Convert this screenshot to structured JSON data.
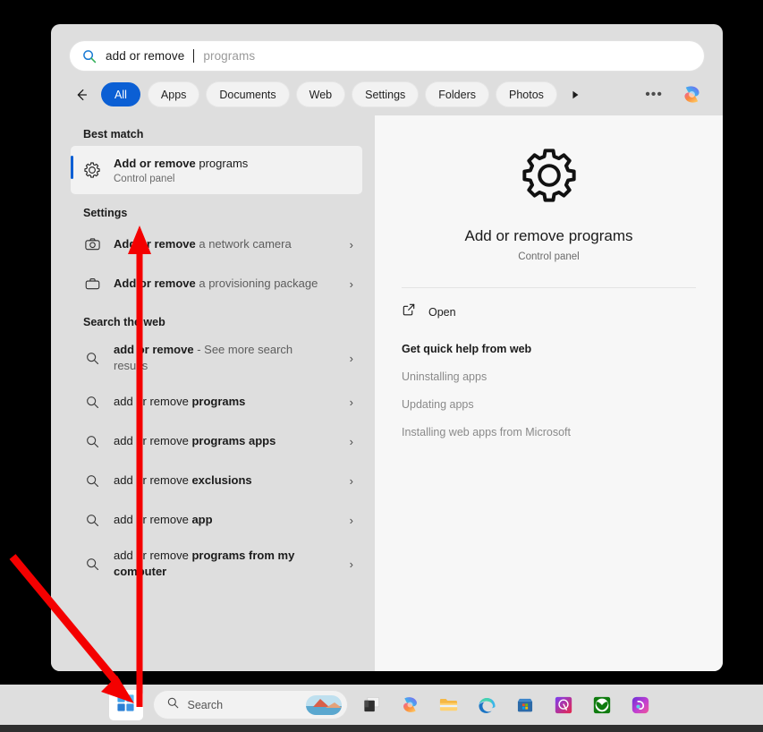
{
  "search": {
    "typed_text": "add or remove",
    "suggestion_text": "programs",
    "search_icon": "search-icon"
  },
  "filters": {
    "back_icon": "back-arrow-icon",
    "chips": [
      {
        "label": "All",
        "active": true
      },
      {
        "label": "Apps",
        "active": false
      },
      {
        "label": "Documents",
        "active": false
      },
      {
        "label": "Web",
        "active": false
      },
      {
        "label": "Settings",
        "active": false
      },
      {
        "label": "Folders",
        "active": false
      },
      {
        "label": "Photos",
        "active": false
      }
    ],
    "more_icon": "play-arrow-icon",
    "overflow_label": "•••",
    "copilot_icon": "copilot-icon"
  },
  "results": {
    "best_match": {
      "heading": "Best match",
      "icon": "gear-icon",
      "title_bold": "Add or remove",
      "title_rest": " programs",
      "subtitle": "Control panel"
    },
    "settings": {
      "heading": "Settings",
      "items": [
        {
          "icon": "camera-icon",
          "bold": "Add or remove",
          "rest": " a network camera",
          "chevron": "›"
        },
        {
          "icon": "briefcase-icon",
          "bold": "Add or remove",
          "rest": " a provisioning package",
          "chevron": "›"
        }
      ]
    },
    "web": {
      "heading": "Search the web",
      "items": [
        {
          "icon": "search-icon",
          "bold": "add or remove",
          "rest": " - See more search results",
          "rest_dim": true,
          "chevron": "›"
        },
        {
          "icon": "search-icon",
          "plain": "add or remove ",
          "bold": "programs",
          "chevron": "›"
        },
        {
          "icon": "search-icon",
          "plain": "add or remove ",
          "bold": "programs apps",
          "chevron": "›"
        },
        {
          "icon": "search-icon",
          "plain": "add or remove ",
          "bold": "exclusions",
          "chevron": "›"
        },
        {
          "icon": "search-icon",
          "plain": "add or remove ",
          "bold": "app",
          "chevron": "›"
        },
        {
          "icon": "search-icon",
          "plain": "add or remove ",
          "bold": "programs from my computer",
          "chevron": "›"
        }
      ]
    }
  },
  "preview": {
    "icon": "gear-icon",
    "title": "Add or remove programs",
    "subtitle": "Control panel",
    "open_icon": "open-external-icon",
    "open_label": "Open",
    "help_heading": "Get quick help from web",
    "help_links": [
      "Uninstalling apps",
      "Updating apps",
      "Installing web apps from Microsoft"
    ]
  },
  "taskbar": {
    "start_icon": "windows-start-icon",
    "search_icon": "search-icon",
    "search_placeholder": "Search",
    "search_thumbnail": "photo-thumbnail",
    "icons": [
      {
        "name": "task-view-icon"
      },
      {
        "name": "copilot-icon"
      },
      {
        "name": "file-explorer-icon"
      },
      {
        "name": "edge-icon"
      },
      {
        "name": "microsoft-store-icon"
      },
      {
        "name": "phone-link-icon"
      },
      {
        "name": "xbox-icon"
      },
      {
        "name": "clipchamp-icon"
      }
    ]
  },
  "annotations": {
    "arrow_color": "#f40000",
    "arrows": [
      {
        "name": "arrow-to-start-button",
        "type": "diagonal"
      },
      {
        "name": "arrow-start-to-best-match",
        "type": "vertical"
      }
    ]
  },
  "colors": {
    "accent_blue": "#0b5fd4",
    "panel_bg": "#dedede",
    "preview_bg": "#f7f7f7",
    "annotation_red": "#f40000"
  }
}
